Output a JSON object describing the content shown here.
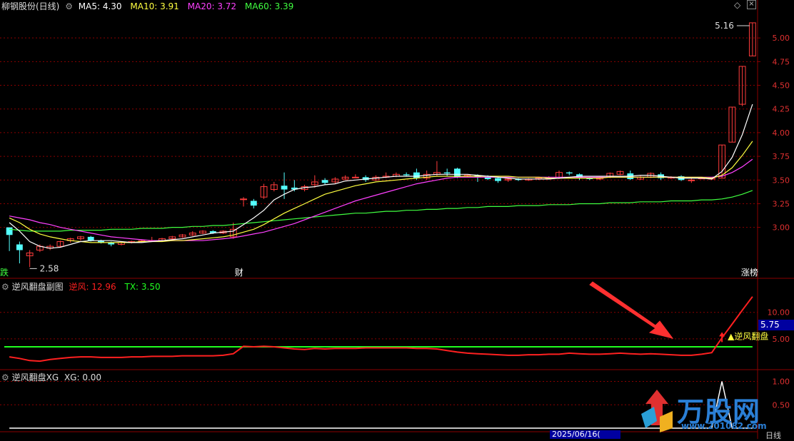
{
  "main_panel": {
    "stock_name": "柳钢股份(日线)",
    "ma5": "MA5: 4.30",
    "ma10": "MA10: 3.91",
    "ma20": "MA20: 3.72",
    "ma60": "MA60: 3.39",
    "high_label": "5.16",
    "low_label": "2.58",
    "marker_die": "跌",
    "marker_cai": "财",
    "marker_zhangbang": "涨榜"
  },
  "sub_panel1": {
    "title": "逆风翻盘副图",
    "nifeng": "逆风: 12.96",
    "tx": "TX: 3.50",
    "current_value": "5.75",
    "signal_label": "▲逆风翻盘"
  },
  "sub_panel2": {
    "title": "逆风翻盘XG",
    "xg": "XG: 0.00"
  },
  "bottom_bar": {
    "date_label": "2025/06/16(",
    "period_label": "日线"
  },
  "watermark": {
    "brand": "万股网",
    "url": "www.201082.com"
  },
  "colors": {
    "up": "#ff3c3c",
    "down": "#54ffff",
    "ma5": "#ffffff",
    "ma10": "#ffff40",
    "ma20": "#ff40ff",
    "ma60": "#40ff40",
    "nifeng": "#ff2020",
    "tx": "#20ff20",
    "grid": "#8b0000"
  },
  "chart_data": [
    {
      "type": "candlestick",
      "title": "柳钢股份(日线)",
      "ylim": [
        2.5,
        5.25
      ],
      "yticks": [
        3.0,
        3.25,
        3.5,
        3.75,
        4.0,
        4.25,
        4.5,
        4.75,
        5.0
      ],
      "candles": [
        [
          3.0,
          2.92,
          3.0,
          2.75
        ],
        [
          2.82,
          2.76,
          2.85,
          2.62
        ],
        [
          2.7,
          2.73,
          2.76,
          2.58
        ],
        [
          2.76,
          2.8,
          2.82,
          2.74
        ],
        [
          2.78,
          2.8,
          2.82,
          2.76
        ],
        [
          2.8,
          2.85,
          2.86,
          2.79
        ],
        [
          2.86,
          2.88,
          2.89,
          2.84
        ],
        [
          2.88,
          2.9,
          2.91,
          2.86
        ],
        [
          2.9,
          2.86,
          2.91,
          2.85
        ],
        [
          2.86,
          2.84,
          2.87,
          2.83
        ],
        [
          2.84,
          2.82,
          2.85,
          2.8
        ],
        [
          2.82,
          2.84,
          2.85,
          2.81
        ],
        [
          2.84,
          2.85,
          2.86,
          2.83
        ],
        [
          2.85,
          2.86,
          2.87,
          2.84
        ],
        [
          2.86,
          2.86,
          2.9,
          2.85
        ],
        [
          2.86,
          2.88,
          2.89,
          2.85
        ],
        [
          2.88,
          2.9,
          2.91,
          2.87
        ],
        [
          2.9,
          2.92,
          2.93,
          2.89
        ],
        [
          2.92,
          2.94,
          2.96,
          2.91
        ],
        [
          2.94,
          2.96,
          2.97,
          2.93
        ],
        [
          2.96,
          2.94,
          2.97,
          2.93
        ],
        [
          2.94,
          2.96,
          2.97,
          2.93
        ],
        [
          2.9,
          2.98,
          3.05,
          2.88
        ],
        [
          3.3,
          3.3,
          3.32,
          3.22
        ],
        [
          3.28,
          3.23,
          3.3,
          3.2
        ],
        [
          3.32,
          3.43,
          3.46,
          3.3
        ],
        [
          3.4,
          3.45,
          3.48,
          3.38
        ],
        [
          3.44,
          3.4,
          3.58,
          3.3
        ],
        [
          3.42,
          3.4,
          3.5,
          3.38
        ],
        [
          3.4,
          3.43,
          3.45,
          3.38
        ],
        [
          3.45,
          3.48,
          3.55,
          3.42
        ],
        [
          3.5,
          3.47,
          3.52,
          3.45
        ],
        [
          3.48,
          3.51,
          3.53,
          3.46
        ],
        [
          3.51,
          3.53,
          3.55,
          3.5
        ],
        [
          3.53,
          3.53,
          3.56,
          3.52
        ],
        [
          3.53,
          3.5,
          3.55,
          3.48
        ],
        [
          3.5,
          3.53,
          3.55,
          3.49
        ],
        [
          3.53,
          3.54,
          3.58,
          3.52
        ],
        [
          3.54,
          3.56,
          3.58,
          3.53
        ],
        [
          3.56,
          3.55,
          3.58,
          3.54
        ],
        [
          3.58,
          3.52,
          3.62,
          3.5
        ],
        [
          3.52,
          3.56,
          3.6,
          3.5
        ],
        [
          3.56,
          3.58,
          3.7,
          3.54
        ],
        [
          3.58,
          3.57,
          3.62,
          3.54
        ],
        [
          3.62,
          3.53,
          3.63,
          3.52
        ],
        [
          3.54,
          3.55,
          3.56,
          3.53
        ],
        [
          3.55,
          3.53,
          3.56,
          3.48
        ],
        [
          3.53,
          3.51,
          3.55,
          3.5
        ],
        [
          3.52,
          3.49,
          3.53,
          3.47
        ],
        [
          3.5,
          3.51,
          3.52,
          3.48
        ],
        [
          3.51,
          3.5,
          3.52,
          3.49
        ],
        [
          3.5,
          3.51,
          3.52,
          3.49
        ],
        [
          3.51,
          3.52,
          3.53,
          3.5
        ],
        [
          3.52,
          3.52,
          3.54,
          3.51
        ],
        [
          3.52,
          3.58,
          3.6,
          3.51
        ],
        [
          3.58,
          3.57,
          3.59,
          3.55
        ],
        [
          3.56,
          3.52,
          3.57,
          3.5
        ],
        [
          3.52,
          3.51,
          3.53,
          3.5
        ],
        [
          3.51,
          3.53,
          3.54,
          3.5
        ],
        [
          3.53,
          3.57,
          3.58,
          3.52
        ],
        [
          3.56,
          3.59,
          3.6,
          3.55
        ],
        [
          3.57,
          3.51,
          3.6,
          3.5
        ],
        [
          3.51,
          3.53,
          3.55,
          3.5
        ],
        [
          3.53,
          3.57,
          3.58,
          3.52
        ],
        [
          3.56,
          3.52,
          3.58,
          3.5
        ],
        [
          3.52,
          3.53,
          3.54,
          3.51
        ],
        [
          3.54,
          3.5,
          3.55,
          3.49
        ],
        [
          3.5,
          3.5,
          3.52,
          3.47
        ],
        [
          3.52,
          3.52,
          3.53,
          3.51
        ],
        [
          3.51,
          3.52,
          3.53,
          3.5
        ],
        [
          3.52,
          3.87,
          3.87,
          3.52
        ],
        [
          3.9,
          4.27,
          4.27,
          3.9
        ],
        [
          4.3,
          4.7,
          4.7,
          4.28
        ],
        [
          4.81,
          5.16,
          5.16,
          4.81
        ]
      ],
      "ma5": [
        3.05,
        2.96,
        2.85,
        2.8,
        2.78,
        2.79,
        2.82,
        2.85,
        2.86,
        2.86,
        2.86,
        2.85,
        2.84,
        2.84,
        2.85,
        2.86,
        2.87,
        2.88,
        2.9,
        2.92,
        2.94,
        2.95,
        2.96,
        3.03,
        3.1,
        3.18,
        3.29,
        3.35,
        3.4,
        3.42,
        3.43,
        3.45,
        3.46,
        3.49,
        3.5,
        3.51,
        3.52,
        3.53,
        3.54,
        3.54,
        3.54,
        3.55,
        3.56,
        3.56,
        3.56,
        3.56,
        3.55,
        3.54,
        3.53,
        3.52,
        3.51,
        3.51,
        3.51,
        3.51,
        3.52,
        3.53,
        3.54,
        3.54,
        3.54,
        3.54,
        3.54,
        3.54,
        3.55,
        3.55,
        3.54,
        3.53,
        3.52,
        3.52,
        3.52,
        3.51,
        3.59,
        3.74,
        3.98,
        4.3
      ],
      "ma10": [
        3.1,
        3.05,
        2.98,
        2.93,
        2.9,
        2.88,
        2.86,
        2.85,
        2.84,
        2.84,
        2.84,
        2.84,
        2.84,
        2.85,
        2.85,
        2.85,
        2.86,
        2.86,
        2.87,
        2.88,
        2.89,
        2.9,
        2.92,
        2.95,
        2.98,
        3.03,
        3.09,
        3.15,
        3.2,
        3.25,
        3.3,
        3.35,
        3.38,
        3.41,
        3.44,
        3.46,
        3.48,
        3.49,
        3.5,
        3.51,
        3.52,
        3.53,
        3.54,
        3.54,
        3.54,
        3.54,
        3.54,
        3.54,
        3.54,
        3.54,
        3.53,
        3.53,
        3.53,
        3.52,
        3.52,
        3.52,
        3.52,
        3.52,
        3.52,
        3.53,
        3.53,
        3.53,
        3.53,
        3.53,
        3.53,
        3.53,
        3.53,
        3.53,
        3.53,
        3.52,
        3.55,
        3.63,
        3.76,
        3.91
      ],
      "ma20": [
        3.12,
        3.1,
        3.08,
        3.05,
        3.03,
        3.0,
        2.98,
        2.96,
        2.94,
        2.92,
        2.9,
        2.89,
        2.88,
        2.87,
        2.86,
        2.86,
        2.86,
        2.86,
        2.86,
        2.86,
        2.87,
        2.88,
        2.89,
        2.91,
        2.93,
        2.95,
        2.98,
        3.01,
        3.04,
        3.08,
        3.12,
        3.16,
        3.2,
        3.24,
        3.28,
        3.31,
        3.34,
        3.37,
        3.4,
        3.43,
        3.46,
        3.48,
        3.5,
        3.52,
        3.53,
        3.53,
        3.53,
        3.53,
        3.53,
        3.53,
        3.53,
        3.53,
        3.53,
        3.53,
        3.53,
        3.53,
        3.53,
        3.53,
        3.53,
        3.53,
        3.53,
        3.53,
        3.53,
        3.53,
        3.53,
        3.53,
        3.53,
        3.53,
        3.53,
        3.53,
        3.54,
        3.58,
        3.64,
        3.72
      ],
      "ma60": [
        2.98,
        2.97,
        2.96,
        2.96,
        2.96,
        2.96,
        2.97,
        2.97,
        2.97,
        2.97,
        2.98,
        2.98,
        2.98,
        2.99,
        2.99,
        2.99,
        3.0,
        3.0,
        3.01,
        3.01,
        3.02,
        3.02,
        3.03,
        3.04,
        3.05,
        3.06,
        3.07,
        3.08,
        3.09,
        3.1,
        3.11,
        3.12,
        3.13,
        3.14,
        3.15,
        3.15,
        3.16,
        3.17,
        3.17,
        3.18,
        3.18,
        3.19,
        3.19,
        3.2,
        3.2,
        3.21,
        3.21,
        3.22,
        3.22,
        3.22,
        3.23,
        3.23,
        3.23,
        3.24,
        3.24,
        3.24,
        3.25,
        3.25,
        3.25,
        3.26,
        3.26,
        3.26,
        3.27,
        3.27,
        3.27,
        3.28,
        3.28,
        3.28,
        3.29,
        3.29,
        3.3,
        3.32,
        3.35,
        3.39
      ]
    },
    {
      "type": "line",
      "title": "逆风翻盘副图",
      "ylim": [
        0,
        14
      ],
      "yticks": [
        5.0,
        10.0
      ],
      "series": [
        {
          "name": "逆风",
          "values": [
            1.6,
            1.3,
            0.9,
            0.8,
            1.1,
            1.3,
            1.5,
            1.6,
            1.6,
            1.5,
            1.5,
            1.5,
            1.6,
            1.6,
            1.7,
            1.7,
            1.7,
            1.8,
            1.8,
            1.8,
            1.8,
            1.9,
            2.2,
            3.6,
            3.5,
            3.6,
            3.5,
            3.3,
            3.1,
            3.0,
            3.2,
            3.1,
            3.2,
            3.2,
            3.2,
            3.3,
            3.3,
            3.3,
            3.3,
            3.3,
            3.2,
            3.2,
            3.1,
            2.8,
            2.5,
            2.3,
            2.2,
            2.1,
            2.0,
            1.9,
            1.9,
            2.0,
            2.0,
            2.1,
            2.1,
            2.3,
            2.2,
            2.1,
            2.1,
            2.2,
            2.3,
            2.2,
            2.1,
            2.2,
            2.1,
            2.0,
            1.9,
            1.9,
            2.1,
            2.4,
            5.2,
            7.8,
            10.4,
            12.96
          ]
        },
        {
          "name": "TX",
          "values": [
            3.5
          ]
        }
      ]
    },
    {
      "type": "line",
      "title": "逆风翻盘XG",
      "ylim": [
        0,
        1.1
      ],
      "yticks": [
        0.5,
        1.0
      ],
      "series": [
        {
          "name": "XG",
          "values": [
            0,
            0,
            0,
            0,
            0,
            0,
            0,
            0,
            0,
            0,
            0,
            0,
            0,
            0,
            0,
            0,
            0,
            0,
            0,
            0,
            0,
            0,
            0,
            0,
            0,
            0,
            0,
            0,
            0,
            0,
            0,
            0,
            0,
            0,
            0,
            0,
            0,
            0,
            0,
            0,
            0,
            0,
            0,
            0,
            0,
            0,
            0,
            0,
            0,
            0,
            0,
            0,
            0,
            0,
            0,
            0,
            0,
            0,
            0,
            0,
            0,
            0,
            0,
            0,
            0,
            0,
            0,
            0,
            0,
            0,
            1,
            0,
            0,
            0
          ]
        }
      ]
    }
  ]
}
